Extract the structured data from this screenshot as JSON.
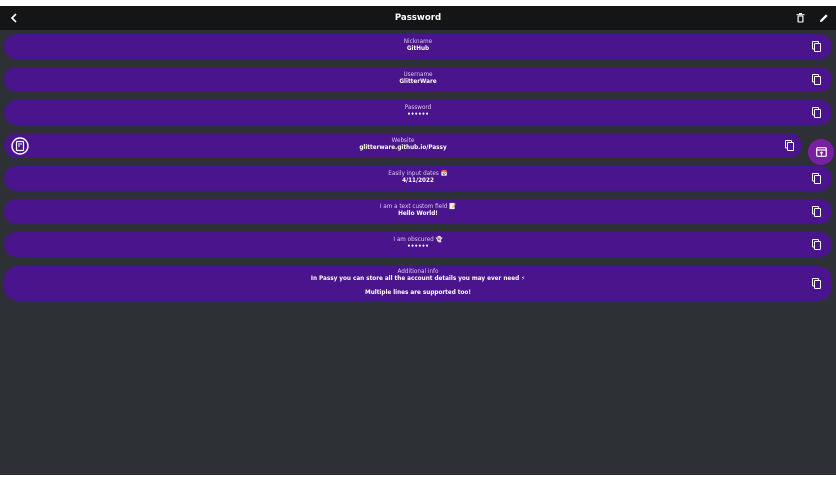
{
  "app_bar": {
    "title": "Password",
    "back_icon": "arrow-back-icon",
    "delete_icon": "trash-icon",
    "edit_icon": "pencil-icon"
  },
  "colors": {
    "background": "#2d3136",
    "app_bar": "#131517",
    "row": "#4a148c",
    "fab": "#7b1fa2"
  },
  "entries": [
    {
      "label": "Nickname",
      "value": "GitHub"
    },
    {
      "label": "Username",
      "value": "GlitterWare"
    },
    {
      "label": "Password",
      "value": "••••••"
    },
    {
      "label": "Website",
      "value": "glitterware.github.io/Passy"
    },
    {
      "label": "Easily input dates 📅",
      "value": "4/11/2022"
    },
    {
      "label": "I am a text custom field 📝",
      "value": "Hello World!"
    },
    {
      "label": "I am obscured 👻",
      "value": "••••••"
    },
    {
      "label": "Additional info",
      "value": "In Passy you can store all the account details you may ever need ⚡",
      "value2": "Multiple lines are supported too!"
    }
  ],
  "icons": {
    "copy": "copy-icon",
    "website_favicon": "passy-logo-icon",
    "open_website": "open-in-browser-icon"
  }
}
